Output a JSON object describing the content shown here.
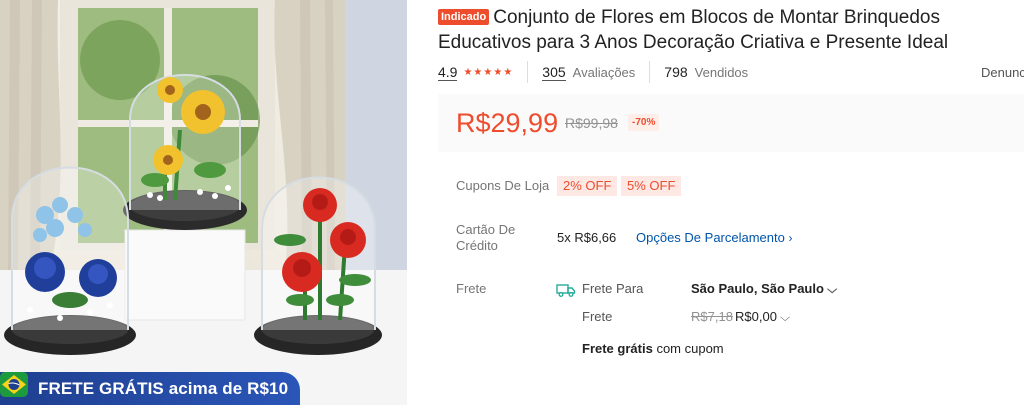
{
  "promo": {
    "text": "FRETE GRÁTIS acima de R$10"
  },
  "product": {
    "badge": "Indicado",
    "title": "Conjunto de Flores em Blocos de Montar Brinquedos Educativos para 3 Anos Decoração Criativa e Presente Ideal"
  },
  "rating": {
    "score": "4.9",
    "stars": "★★★★★",
    "reviews_count": "305",
    "reviews_label": "Avaliações",
    "sold_count": "798",
    "sold_label": "Vendidos",
    "report_label": "Denunciar"
  },
  "price": {
    "current": "R$29,99",
    "original": "R$99,98",
    "discount": "-70%"
  },
  "coupons": {
    "label": "Cupons De Loja",
    "items": [
      "2% OFF",
      "5% OFF"
    ]
  },
  "credit": {
    "label": "Cartão De Crédito",
    "installments": "5x R$6,66",
    "options_link": "Opções De Parcelamento"
  },
  "shipping": {
    "label": "Frete",
    "to_label": "Frete Para",
    "destination": "São Paulo, São Paulo",
    "cost_label": "Frete",
    "cost_original": "R$7,18",
    "cost_current": "R$0,00",
    "free_bold": "Frete grátis",
    "free_rest": "com cupom"
  },
  "colors": {
    "accent": "#ee4d2d",
    "link": "#0055aa",
    "promo_bar": "#2a56b8"
  }
}
